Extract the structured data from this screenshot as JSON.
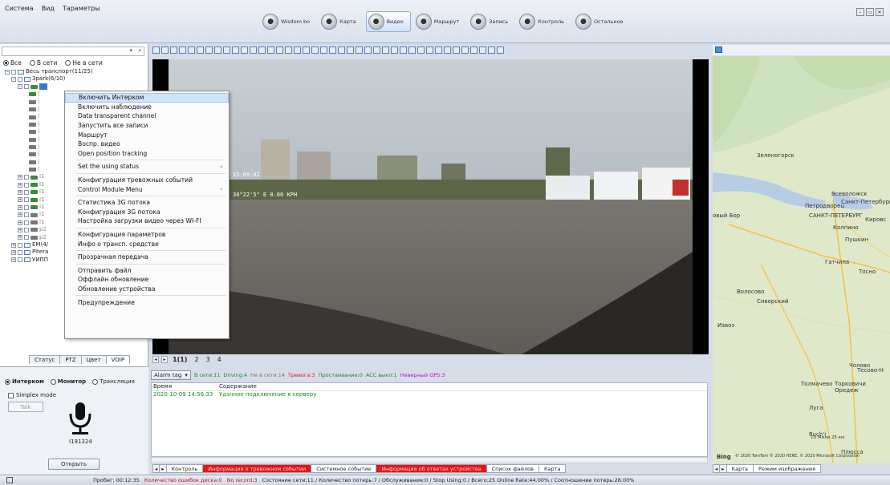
{
  "menu": [
    "Система",
    "Вид",
    "Тараметры"
  ],
  "nav_tabs": [
    {
      "label": "Wisdom bo",
      "icon": "wisdom-icon"
    },
    {
      "label": "Карта",
      "icon": "map-icon"
    },
    {
      "label": "Видео",
      "icon": "video-icon",
      "active": true
    },
    {
      "label": "Маршрут",
      "icon": "route-icon"
    },
    {
      "label": "Запись",
      "icon": "record-icon"
    },
    {
      "label": "Контроль",
      "icon": "control-icon"
    },
    {
      "label": "Остальное",
      "icon": "other-icon"
    }
  ],
  "left": {
    "filters": [
      "Все",
      "В сети",
      "Не в сети"
    ],
    "tree": [
      {
        "label": "Весь транспорт(11/25)"
      },
      {
        "label": "Зpark(6/10)"
      },
      {
        "label": "EM(4/"
      },
      {
        "label": "Pitera"
      },
      {
        "label": "УИПП"
      }
    ],
    "tabs": [
      "Статус",
      "PTZ",
      "Цвет",
      "VOIP"
    ],
    "modes": [
      "Интерком",
      "Монитор",
      "Трансляция"
    ],
    "simplex": "Simplex mode",
    "talk": "Talk",
    "device_id": "I191324",
    "open": "Открыть"
  },
  "video": {
    "overlay_time": "15:09:02",
    "overlay_speed": "30°22'5\" E 0.00 KPH",
    "tabs": [
      "1(1)",
      "2",
      "3",
      "4"
    ]
  },
  "alarm": {
    "tag_label": "Alarm tag",
    "stats": [
      {
        "text": "В сети:11",
        "color": "#1f8a1f"
      },
      {
        "text": "Driving:4",
        "color": "#1f8a1f"
      },
      {
        "text": "Не в сети:14",
        "color": "#777777"
      },
      {
        "text": "Тревога:3",
        "color": "#e01515"
      },
      {
        "text": "Простаивание:0",
        "color": "#1f8a1f"
      },
      {
        "text": "ACC выкл:1",
        "color": "#1f8a1f"
      },
      {
        "text": "Неверный GPS:3",
        "color": "#d000d0"
      }
    ],
    "columns": [
      "Время",
      "Содержание"
    ],
    "rows": [
      {
        "time": "2020-10-09 14:56:33",
        "content": "Удачное подключение к серверу"
      }
    ]
  },
  "bottom_tabs": [
    {
      "label": "Контроль",
      "red": false
    },
    {
      "label": "Информация о тревожном событии",
      "red": true
    },
    {
      "label": "Системное событие",
      "red": false
    },
    {
      "label": "Информация об ответах устройства",
      "red": true
    },
    {
      "label": "Список файлов",
      "red": false
    },
    {
      "label": "Карта",
      "red": false
    }
  ],
  "map": {
    "labels": [
      {
        "text": "Зеленогорск"
      },
      {
        "text": "Всеволожск"
      },
      {
        "text": "Петродворец"
      },
      {
        "text": "Санкт-Петербург"
      },
      {
        "text": "овый Бор"
      },
      {
        "text": "САНКТ-ПЕТЕРБУРГ"
      },
      {
        "text": "Кировс"
      },
      {
        "text": "Колпино"
      },
      {
        "text": "Пушкин"
      },
      {
        "text": "Гатчина"
      },
      {
        "text": "Тосно"
      },
      {
        "text": "Волосово"
      },
      {
        "text": "Сиверский"
      },
      {
        "text": "Извоз"
      },
      {
        "text": "Толмачево"
      },
      {
        "text": "Торковичи"
      },
      {
        "text": "Оредеж"
      },
      {
        "text": "Луга"
      },
      {
        "text": "Чолово"
      },
      {
        "text": "Тесово-Н"
      },
      {
        "text": "Ruch'i"
      },
      {
        "text": "Плюсса"
      }
    ],
    "bing": "Bing",
    "copyright": "© 2020 TomTom © 2020 HERE, © 2020 Microsoft Corporation",
    "scale": "10 Мили   25 км",
    "terms": "Terms",
    "tabs": [
      "Карта",
      "Режим изображения"
    ]
  },
  "status": {
    "mileage": "Пробег: 00:12:35",
    "disk_errors": "Количество ошибок диска:0",
    "no_record": "No record:3",
    "summary": "Состояние сети:11 / Количество потерь:7 / Обслуживание:0 / Stop Using:0 / Всего:25   Online Rate:44.00% / Соотношение потерь:28.00%"
  },
  "context_menu": {
    "items": [
      {
        "label": "Включить Интерком",
        "highlight": true
      },
      {
        "label": "Включить наблюдение"
      },
      {
        "label": "Data transparent channel"
      },
      {
        "label": "Запустить все записи"
      },
      {
        "label": "Маршрут"
      },
      {
        "label": "Воспр. видео"
      },
      {
        "label": "Open position tracking"
      },
      {
        "sep": true
      },
      {
        "label": "Set the using status",
        "submenu": true
      },
      {
        "sep": true
      },
      {
        "label": "Конфигурация тревожных событий"
      },
      {
        "label": "Control Module Menu",
        "submenu": true
      },
      {
        "sep": true
      },
      {
        "label": "Статистика 3G потока"
      },
      {
        "label": "Конфигурация 3G потока"
      },
      {
        "label": "Настройка загрузки видео через WI-FI"
      },
      {
        "sep": true
      },
      {
        "label": "Конфигурация параметров"
      },
      {
        "label": "Инфо о трансп. средстве"
      },
      {
        "sep": true
      },
      {
        "label": "Прозрачная передача"
      },
      {
        "sep": true
      },
      {
        "label": "Отправить файл"
      },
      {
        "label": "Оффлайн обновление"
      },
      {
        "label": "Обновление устройства"
      },
      {
        "sep": true
      },
      {
        "label": "Предупреждение"
      }
    ]
  },
  "colors": {
    "accent": "#4a90d9",
    "red_tab": "#e81515"
  }
}
